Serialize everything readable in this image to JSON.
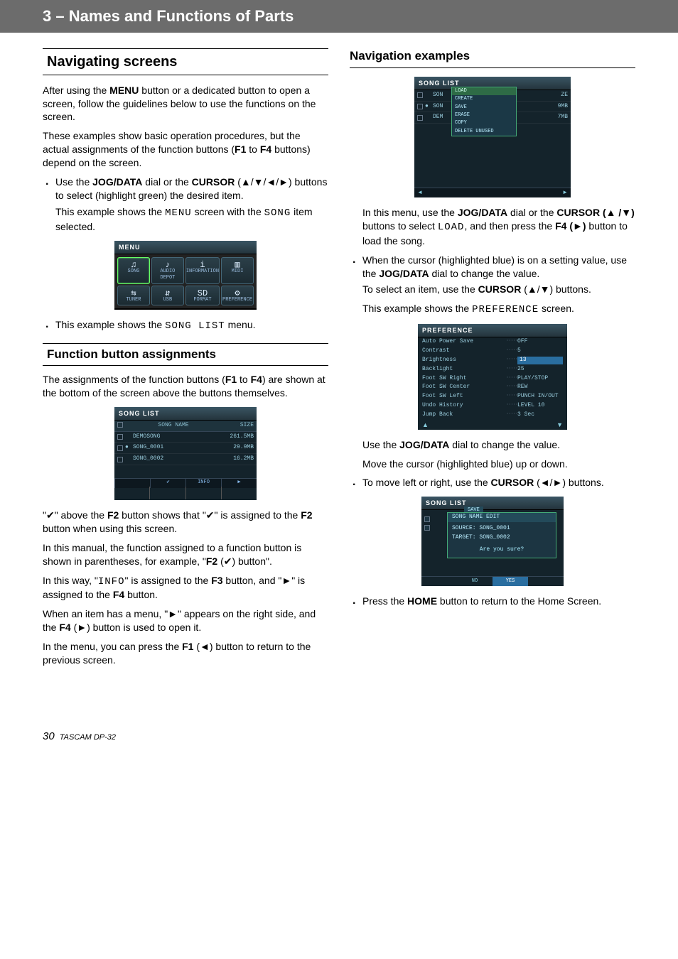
{
  "header": {
    "title": "3 – Names and Functions of Parts"
  },
  "left": {
    "h2": "Navigating screens",
    "p1_a": "After using the ",
    "p1_b": "MENU",
    "p1_c": " button or a dedicated button to open a screen, follow the guidelines below to use the functions on the screen.",
    "p2_a": "These examples show basic operation procedures, but the actual assignments of the function buttons (",
    "p2_b": "F1",
    "p2_c": " to ",
    "p2_d": "F4",
    "p2_e": " buttons) depend on the screen.",
    "li1_a": "Use the ",
    "li1_b": "JOG/DATA",
    "li1_c": " dial or the ",
    "li1_d": "CURSOR",
    "li1_e": " (▲/▼/◄/►) buttons to select (highlight green) the desired item.",
    "li1_sub_a": "This example shows the ",
    "li1_sub_b": "MENU",
    "li1_sub_c": " screen with the ",
    "li1_sub_d": "SONG",
    "li1_sub_e": " item selected.",
    "menu": {
      "title": "MENU",
      "cells": [
        "SONG",
        "AUDIO DEPOT",
        "INFORMATION",
        "MIDI",
        "TUNER",
        "USB",
        "FORMAT",
        "PREFERENCE"
      ],
      "icons": [
        "♫",
        "♪",
        "i",
        "▥",
        "⇆",
        "⇵",
        "SD",
        "⚙"
      ]
    },
    "li2_a": "This example shows the ",
    "li2_b": "SONG LIST",
    "li2_c": " menu.",
    "h3": "Function button assignments",
    "fb_p1_a": "The assignments of the function buttons (",
    "fb_p1_b": "F1",
    "fb_p1_c": " to ",
    "fb_p1_d": "F4",
    "fb_p1_e": ") are shown at the bottom of the screen above the buttons themselves.",
    "songlist": {
      "title": "SONG LIST",
      "head_name": "SONG NAME",
      "head_size": "SIZE",
      "rows": [
        {
          "name": "DEMOSONG",
          "size": "261.5MB",
          "mark": ""
        },
        {
          "name": "SONG_0001",
          "size": "29.9MB",
          "mark": "●"
        },
        {
          "name": "SONG_0002",
          "size": "16.2MB",
          "mark": ""
        }
      ],
      "fbar": [
        "",
        "✔",
        "INFO",
        "▶"
      ]
    },
    "fb_p2_a": "\"✔\" above the ",
    "fb_p2_b": "F2",
    "fb_p2_c": " button shows that \"✔\" is assigned to the ",
    "fb_p2_d": "F2",
    "fb_p2_e": " button when using this screen.",
    "fb_p3_a": "In this manual, the function assigned to a function button is shown in parentheses, for example, \"",
    "fb_p3_b": "F2",
    "fb_p3_c": " (✔) button\".",
    "fb_p4_a": "In this way, \"",
    "fb_p4_b": "INFO",
    "fb_p4_c": "\" is assigned to the ",
    "fb_p4_d": "F3",
    "fb_p4_e": " button, and \"►\" is assigned to the ",
    "fb_p4_f": "F4",
    "fb_p4_g": " button.",
    "fb_p5_a": "When an item has a menu, \"►\" appears on the right side, and the ",
    "fb_p5_b": "F4",
    "fb_p5_c": " (►) button is used to open it.",
    "fb_p6_a": "In the menu, you can press the ",
    "fb_p6_b": "F1",
    "fb_p6_c": " (◄) button to return to the previous screen."
  },
  "right": {
    "h3": "Navigation examples",
    "popup": {
      "title": "SONG LIST",
      "bg_rows": [
        {
          "pre": "SON",
          "post": "",
          "size": "ZE"
        },
        {
          "pre": "SON",
          "post": "",
          "size": "9MB"
        },
        {
          "pre": "DEM",
          "post": "",
          "size": "7MB"
        }
      ],
      "items": [
        "LOAD",
        "CREATE",
        "SAVE",
        "ERASE",
        "COPY",
        "DELETE UNUSED"
      ]
    },
    "p1_a": "In this menu, use the ",
    "p1_b": "JOG/DATA",
    "p1_c": " dial or the ",
    "p1_d": "CURSOR (▲ /▼)",
    "p1_e": " buttons to select ",
    "p1_f": "LOAD",
    "p1_g": ", and then press the ",
    "p1_h": "F4 (►)",
    "p1_i": " button to load the song.",
    "li1_a": "When the cursor (highlighted blue) is on a setting value, use the ",
    "li1_b": "JOG/DATA",
    "li1_c": " dial to change the value.",
    "li1_sub_a": "To select an item, use the ",
    "li1_sub_b": "CURSOR",
    "li1_sub_c": " (▲/▼) buttons.",
    "li1_sub2_a": "This example shows the ",
    "li1_sub2_b": "PREFERENCE",
    "li1_sub2_c": " screen.",
    "pref": {
      "title": "PREFERENCE",
      "rows": [
        {
          "k": "Auto Power Save",
          "v": "OFF",
          "hl": false
        },
        {
          "k": "Contrast",
          "v": "5",
          "hl": false
        },
        {
          "k": "Brightness",
          "v": "13",
          "hl": true
        },
        {
          "k": "Backlight",
          "v": "25",
          "hl": false
        },
        {
          "k": "Foot SW Right",
          "v": "PLAY/STOP",
          "hl": false
        },
        {
          "k": "Foot SW Center",
          "v": "REW",
          "hl": false
        },
        {
          "k": "Foot SW Left",
          "v": "PUNCH IN/OUT",
          "hl": false
        },
        {
          "k": "Undo History",
          "v": "LEVEL 10",
          "hl": false
        },
        {
          "k": "Jump Back",
          "v": "3 Sec",
          "hl": false
        }
      ]
    },
    "p2_a": "Use the ",
    "p2_b": "JOG/DATA",
    "p2_c": " dial to change the value.",
    "p3": "Move the cursor (highlighted blue) up or down.",
    "li2_a": "To move left or right, use the ",
    "li2_b": "CURSOR",
    "li2_c": " (◄/►) buttons.",
    "dialog": {
      "title": "SONG LIST",
      "tab": "SAVE",
      "dlg_title": "SONG NAME EDIT",
      "l1": "SOURCE: SONG_0001",
      "l2": "TARGET: SONG_0002",
      "q": "Are you sure?",
      "btns": [
        "",
        "NO",
        "YES",
        ""
      ]
    },
    "li3_a": "Press the ",
    "li3_b": "HOME",
    "li3_c": " button to return to the Home Screen."
  },
  "footer": {
    "page": "30",
    "model": "TASCAM DP-32"
  }
}
